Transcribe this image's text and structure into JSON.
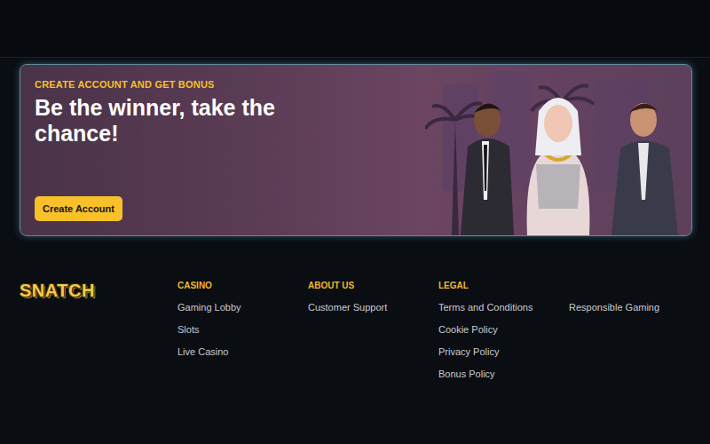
{
  "banner": {
    "eyebrow": "CREATE ACCOUNT AND GET BONUS",
    "headline": "Be the winner, take the chance!",
    "button": "Create Account"
  },
  "footer": {
    "logo": "SNATCH",
    "columns": [
      {
        "title": "CASINO",
        "links": [
          "Gaming Lobby",
          "Slots",
          "Live Casino"
        ]
      },
      {
        "title": "ABOUT US",
        "links": [
          "Customer Support"
        ]
      },
      {
        "title": "LEGAL",
        "links": [
          "Terms and Conditions",
          "Cookie Policy",
          "Privacy Policy",
          "Bonus Policy"
        ]
      },
      {
        "links": [
          "Responsible Gaming"
        ]
      }
    ]
  }
}
